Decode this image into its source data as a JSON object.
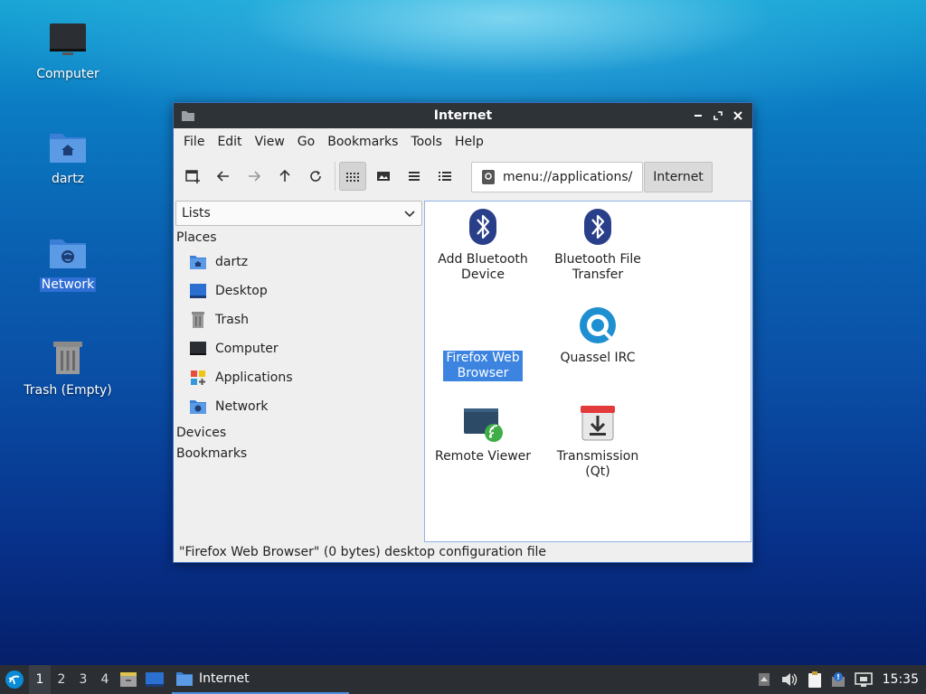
{
  "desktop": {
    "icons": [
      {
        "label": "Computer"
      },
      {
        "label": "dartz"
      },
      {
        "label": "Network"
      },
      {
        "label": "Trash (Empty)"
      }
    ]
  },
  "window": {
    "title": "Internet",
    "menu": [
      "File",
      "Edit",
      "View",
      "Go",
      "Bookmarks",
      "Tools",
      "Help"
    ],
    "address": "menu://applications/",
    "breadcrumb": "Internet",
    "side_pane_mode": "Lists",
    "sidebar": {
      "places_heading": "Places",
      "places": [
        "dartz",
        "Desktop",
        "Trash",
        "Computer",
        "Applications",
        "Network"
      ],
      "devices_heading": "Devices",
      "bookmarks_heading": "Bookmarks"
    },
    "items": [
      {
        "label": "Add Bluetooth Device"
      },
      {
        "label": "Bluetooth File Transfer"
      },
      {
        "label": "Firefox Web Browser"
      },
      {
        "label": "Quassel IRC"
      },
      {
        "label": "Remote Viewer"
      },
      {
        "label": "Transmission (Qt)"
      }
    ],
    "status": "\"Firefox Web Browser\" (0 bytes) desktop configuration file"
  },
  "taskbar": {
    "workspaces": [
      "1",
      "2",
      "3",
      "4"
    ],
    "active_workspace": "1",
    "task_label": "Internet",
    "clock": "15:35"
  },
  "colors": {
    "selection": "#3c84e0",
    "titlebar": "#2e3338",
    "bluetooth": "#2a3f8a",
    "quassel": "#1e8fd0"
  }
}
